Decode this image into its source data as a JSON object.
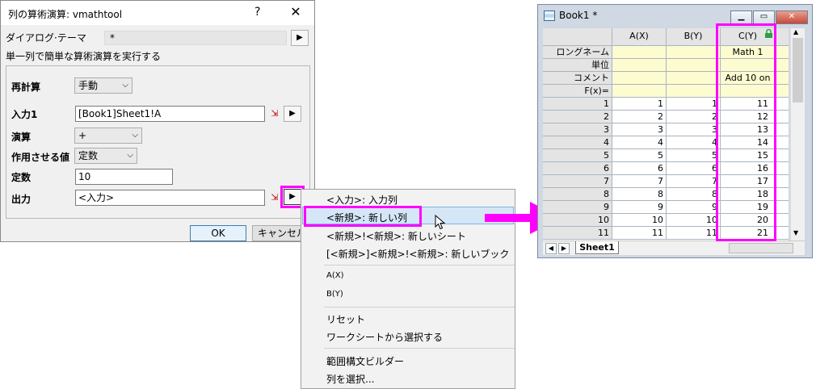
{
  "dialog": {
    "title": "列の算術演算: vmathtool",
    "help": "?",
    "close": "✕",
    "theme_label": "ダイアログ·テーマ",
    "theme_value": "*",
    "description": "単一列で簡単な算術演算を実行する",
    "recalc_label": "再計算",
    "recalc_value": "手動",
    "input1_label": "入力1",
    "input1_value": "[Book1]Sheet1!A",
    "operation_label": "演算",
    "operation_value": "+",
    "operand_label": "作用させる値",
    "operand_value": "定数",
    "constant_label": "定数",
    "constant_value": "10",
    "output_label": "出力",
    "output_value": "<入力>",
    "ok": "OK",
    "cancel": "キャンセル"
  },
  "menu": {
    "items": [
      "<入力>: 入力列",
      "<新規>: 新しい列",
      "<新規>!<新規>: 新しいシート",
      "[<新規>]<新規>!<新規>: 新しいブック",
      "A(X)",
      "B(Y)",
      "リセット",
      "ワークシートから選択する",
      "範囲構文ビルダー",
      "列を選択..."
    ]
  },
  "book": {
    "title": "Book1 *",
    "columns": [
      "A(X)",
      "B(Y)",
      "C(Y)"
    ],
    "meta_rows": [
      {
        "label": "ロングネーム",
        "a": "",
        "b": "",
        "c": "Math 1"
      },
      {
        "label": "単位",
        "a": "",
        "b": "",
        "c": ""
      },
      {
        "label": "コメント",
        "a": "",
        "b": "",
        "c": "Add 10 on"
      },
      {
        "label": "F(x)=",
        "a": "",
        "b": "",
        "c": ""
      }
    ],
    "rows": [
      {
        "n": "1",
        "a": "1",
        "b": "1",
        "c": "11"
      },
      {
        "n": "2",
        "a": "2",
        "b": "2",
        "c": "12"
      },
      {
        "n": "3",
        "a": "3",
        "b": "3",
        "c": "13"
      },
      {
        "n": "4",
        "a": "4",
        "b": "4",
        "c": "14"
      },
      {
        "n": "5",
        "a": "5",
        "b": "5",
        "c": "15"
      },
      {
        "n": "6",
        "a": "6",
        "b": "6",
        "c": "16"
      },
      {
        "n": "7",
        "a": "7",
        "b": "7",
        "c": "17"
      },
      {
        "n": "8",
        "a": "8",
        "b": "8",
        "c": "18"
      },
      {
        "n": "9",
        "a": "9",
        "b": "9",
        "c": "19"
      },
      {
        "n": "10",
        "a": "10",
        "b": "10",
        "c": "20"
      },
      {
        "n": "11",
        "a": "11",
        "b": "11",
        "c": "21"
      }
    ],
    "sheet_tab": "Sheet1"
  },
  "colors": {
    "highlight": "#ff00ff",
    "meta_bg": "#fdfbd0"
  }
}
